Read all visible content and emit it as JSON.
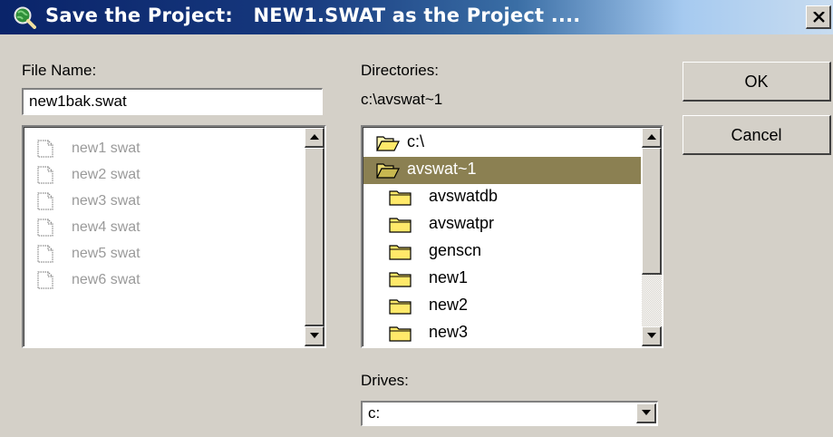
{
  "window": {
    "title": "Save the Project:   NEW1.SWAT as the Project ....",
    "icon": "globe-magnifier-icon",
    "close_icon": "close-icon"
  },
  "file_name": {
    "label": "File Name:",
    "value": "new1bak.swat",
    "files": [
      "new1 swat",
      "new2 swat",
      "new3 swat",
      "new4 swat",
      "new5 swat",
      "new6 swat"
    ]
  },
  "directories": {
    "label": "Directories:",
    "current_path": "c:\\avswat~1",
    "items": [
      {
        "name": "c:\\",
        "icon": "open-folder-icon"
      },
      {
        "name": "avswat~1",
        "icon": "open-folder-icon",
        "selected": true
      },
      {
        "name": "avswatdb",
        "icon": "folder-icon"
      },
      {
        "name": "avswatpr",
        "icon": "folder-icon"
      },
      {
        "name": "genscn",
        "icon": "folder-icon"
      },
      {
        "name": "new1",
        "icon": "folder-icon"
      },
      {
        "name": "new2",
        "icon": "folder-icon"
      },
      {
        "name": "new3",
        "icon": "folder-icon"
      }
    ]
  },
  "drives": {
    "label": "Drives:",
    "selected": "c:"
  },
  "buttons": {
    "ok": "OK",
    "cancel": "Cancel"
  },
  "colors": {
    "title_gradient_start": "#0a246a",
    "title_gradient_end": "#a6caf0",
    "selection": "#8b8052",
    "dialog_face": "#d4d0c8",
    "folder_yellow": "#ffe96a"
  }
}
